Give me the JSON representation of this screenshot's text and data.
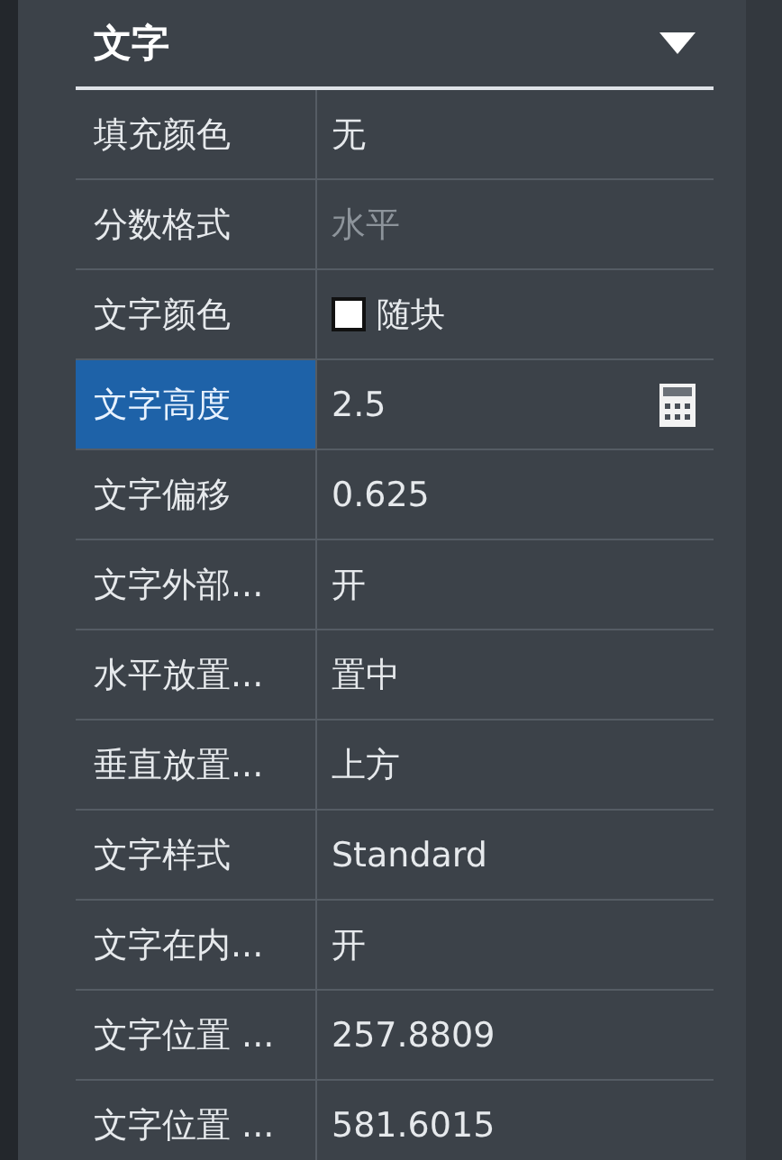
{
  "section": {
    "title": "文字",
    "expanded": true
  },
  "rows": [
    {
      "label": "填充颜色",
      "value": "无",
      "kind": "text",
      "selected": false,
      "disabled": false
    },
    {
      "label": "分数格式",
      "value": "水平",
      "kind": "text",
      "selected": false,
      "disabled": true
    },
    {
      "label": "文字颜色",
      "value": "随块",
      "kind": "swatch",
      "color": "#ffffff",
      "selected": false,
      "disabled": false
    },
    {
      "label": "文字高度",
      "value": "2.5",
      "kind": "calculator",
      "selected": true,
      "disabled": false
    },
    {
      "label": "文字偏移",
      "value": "0.625",
      "kind": "text",
      "selected": false,
      "disabled": false
    },
    {
      "label": "文字外部...",
      "value": "开",
      "kind": "text",
      "selected": false,
      "disabled": false
    },
    {
      "label": "水平放置...",
      "value": "置中",
      "kind": "text",
      "selected": false,
      "disabled": false
    },
    {
      "label": "垂直放置...",
      "value": "上方",
      "kind": "text",
      "selected": false,
      "disabled": false
    },
    {
      "label": "文字样式",
      "value": "Standard",
      "kind": "text",
      "selected": false,
      "disabled": false
    },
    {
      "label": "文字在内...",
      "value": "开",
      "kind": "text",
      "selected": false,
      "disabled": false
    },
    {
      "label": "文字位置 ...",
      "value": "257.8809",
      "kind": "text",
      "selected": false,
      "disabled": false
    },
    {
      "label": "文字位置 ...",
      "value": "581.6015",
      "kind": "text",
      "selected": false,
      "disabled": false
    }
  ]
}
